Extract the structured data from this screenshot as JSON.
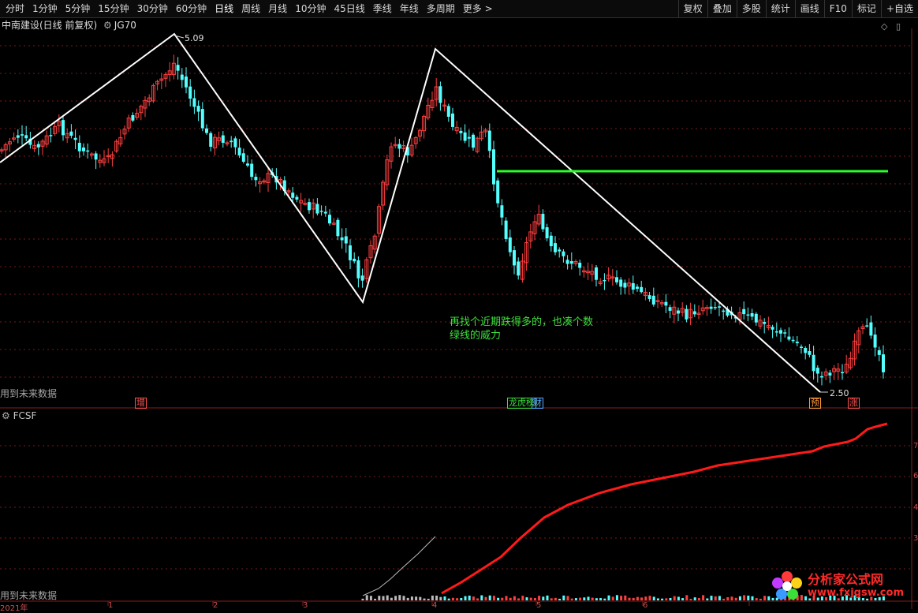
{
  "toolbar": {
    "left_items": [
      "分时",
      "1分钟",
      "5分钟",
      "15分钟",
      "30分钟",
      "60分钟",
      "日线",
      "周线",
      "月线",
      "10分钟",
      "45日线",
      "季线",
      "年线",
      "多周期",
      "更多 >"
    ],
    "active_index": 6,
    "right_items": [
      "复权",
      "叠加",
      "多股",
      "统计",
      "画线",
      "F10",
      "标记",
      "+自选"
    ]
  },
  "main_panel": {
    "title": "中南建设(日线 前复权)",
    "indicator": "JG70",
    "future_data_label": "用到未来数据",
    "high_label": "5.09",
    "low_label": "2.50",
    "annotation": [
      "再找个近期跌得多的，也凑个数",
      "绿线的威力"
    ],
    "event_tags": [
      {
        "text": "增",
        "color": "#ff5050"
      },
      {
        "text": "龙虎榜",
        "color": "#3de03d"
      },
      {
        "text": "财",
        "color": "#5aaaff"
      },
      {
        "text": "预",
        "color": "#ff9a3a"
      },
      {
        "text": "涨",
        "color": "#ff5050"
      }
    ]
  },
  "sub_panel": {
    "title": "FCSF",
    "future_data_label": "用到未来数据",
    "axis_labels": [
      "7",
      "6",
      "4",
      "3"
    ]
  },
  "x_axis": {
    "labels": [
      "2021年",
      "1",
      "2",
      "3",
      "4",
      "5",
      "6"
    ]
  },
  "watermark": {
    "line1": "分析家公式网",
    "line2": "www.fxjgsw.com"
  },
  "colors": {
    "up": "#ff4040",
    "down": "#54ffff",
    "zigzag": "#ffffff",
    "level_line": "#2aff2a",
    "fcsf_line": "#ff1a1a",
    "grid": "#7a1a1a"
  },
  "icons": [
    "gear-icon",
    "diamond-icon",
    "window-icon"
  ]
}
